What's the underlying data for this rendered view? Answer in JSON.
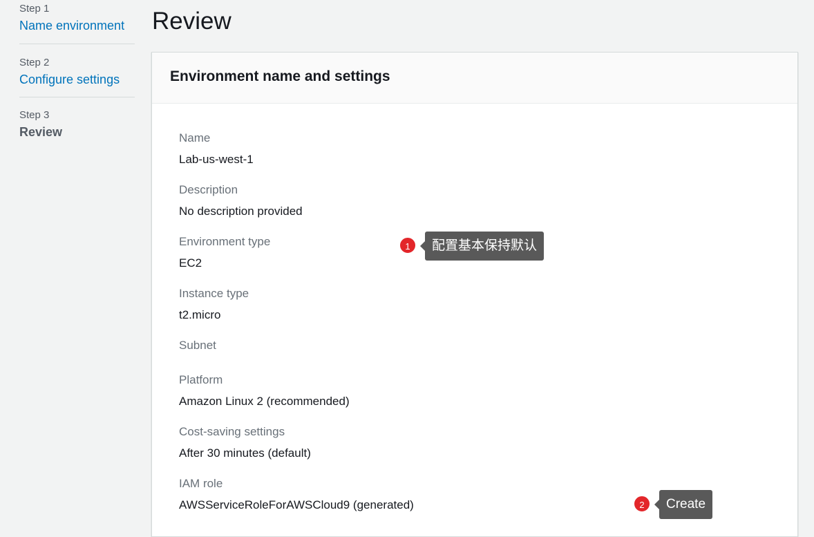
{
  "sidebar": {
    "steps": [
      {
        "number": "Step 1",
        "title": "Name environment"
      },
      {
        "number": "Step 2",
        "title": "Configure settings"
      },
      {
        "number": "Step 3",
        "title": "Review"
      }
    ]
  },
  "page": {
    "title": "Review"
  },
  "panel": {
    "heading": "Environment name and settings",
    "fields": [
      {
        "label": "Name",
        "value": "Lab-us-west-1"
      },
      {
        "label": "Description",
        "value": "No description provided"
      },
      {
        "label": "Environment type",
        "value": "EC2"
      },
      {
        "label": "Instance type",
        "value": "t2.micro"
      },
      {
        "label": "Subnet",
        "value": ""
      },
      {
        "label": "Platform",
        "value": "Amazon Linux 2 (recommended)"
      },
      {
        "label": "Cost-saving settings",
        "value": "After 30 minutes (default)"
      },
      {
        "label": "IAM role",
        "value": "AWSServiceRoleForAWSCloud9 (generated)"
      }
    ]
  },
  "annotations": [
    {
      "number": "1",
      "text": "配置基本保持默认"
    },
    {
      "number": "2",
      "text": "Create"
    }
  ]
}
